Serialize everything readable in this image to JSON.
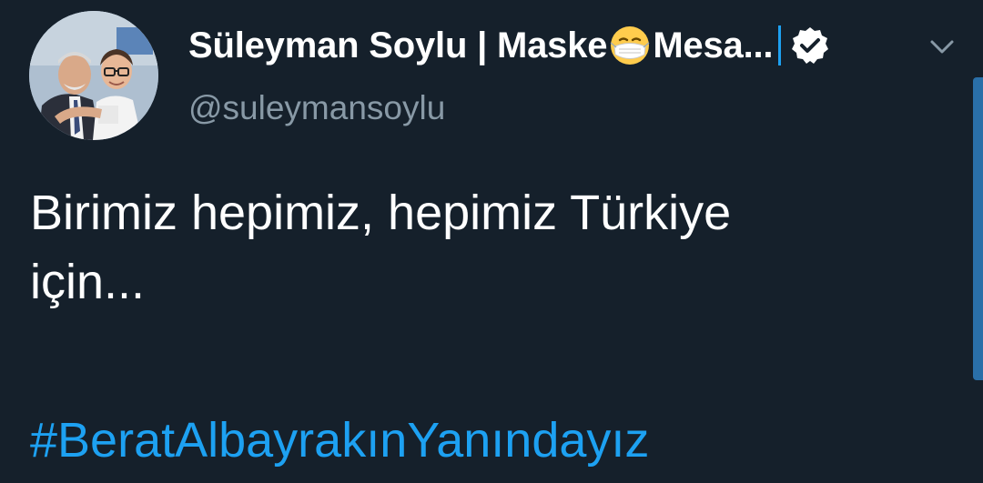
{
  "tweet": {
    "author_name": "Süleyman Soylu | Maske",
    "author_name_after_emoji": "Mesa...",
    "name_emoji": "face-with-medical-mask",
    "verified": true,
    "handle": "@suleymansoylu",
    "text_line_1": "Birimiz hepimiz, hepimiz Türkiye",
    "text_line_2": "için...",
    "hashtag": "#BeratAlbayrakınYanındayız"
  },
  "icons": {
    "more": "chevron-down-icon",
    "verified": "verified-badge-icon",
    "emoji": "face-with-medical-mask-emoji"
  },
  "colors": {
    "background": "#15202b",
    "primary_text": "#ffffff",
    "secondary_text": "#8899a6",
    "link": "#1da1f2"
  }
}
